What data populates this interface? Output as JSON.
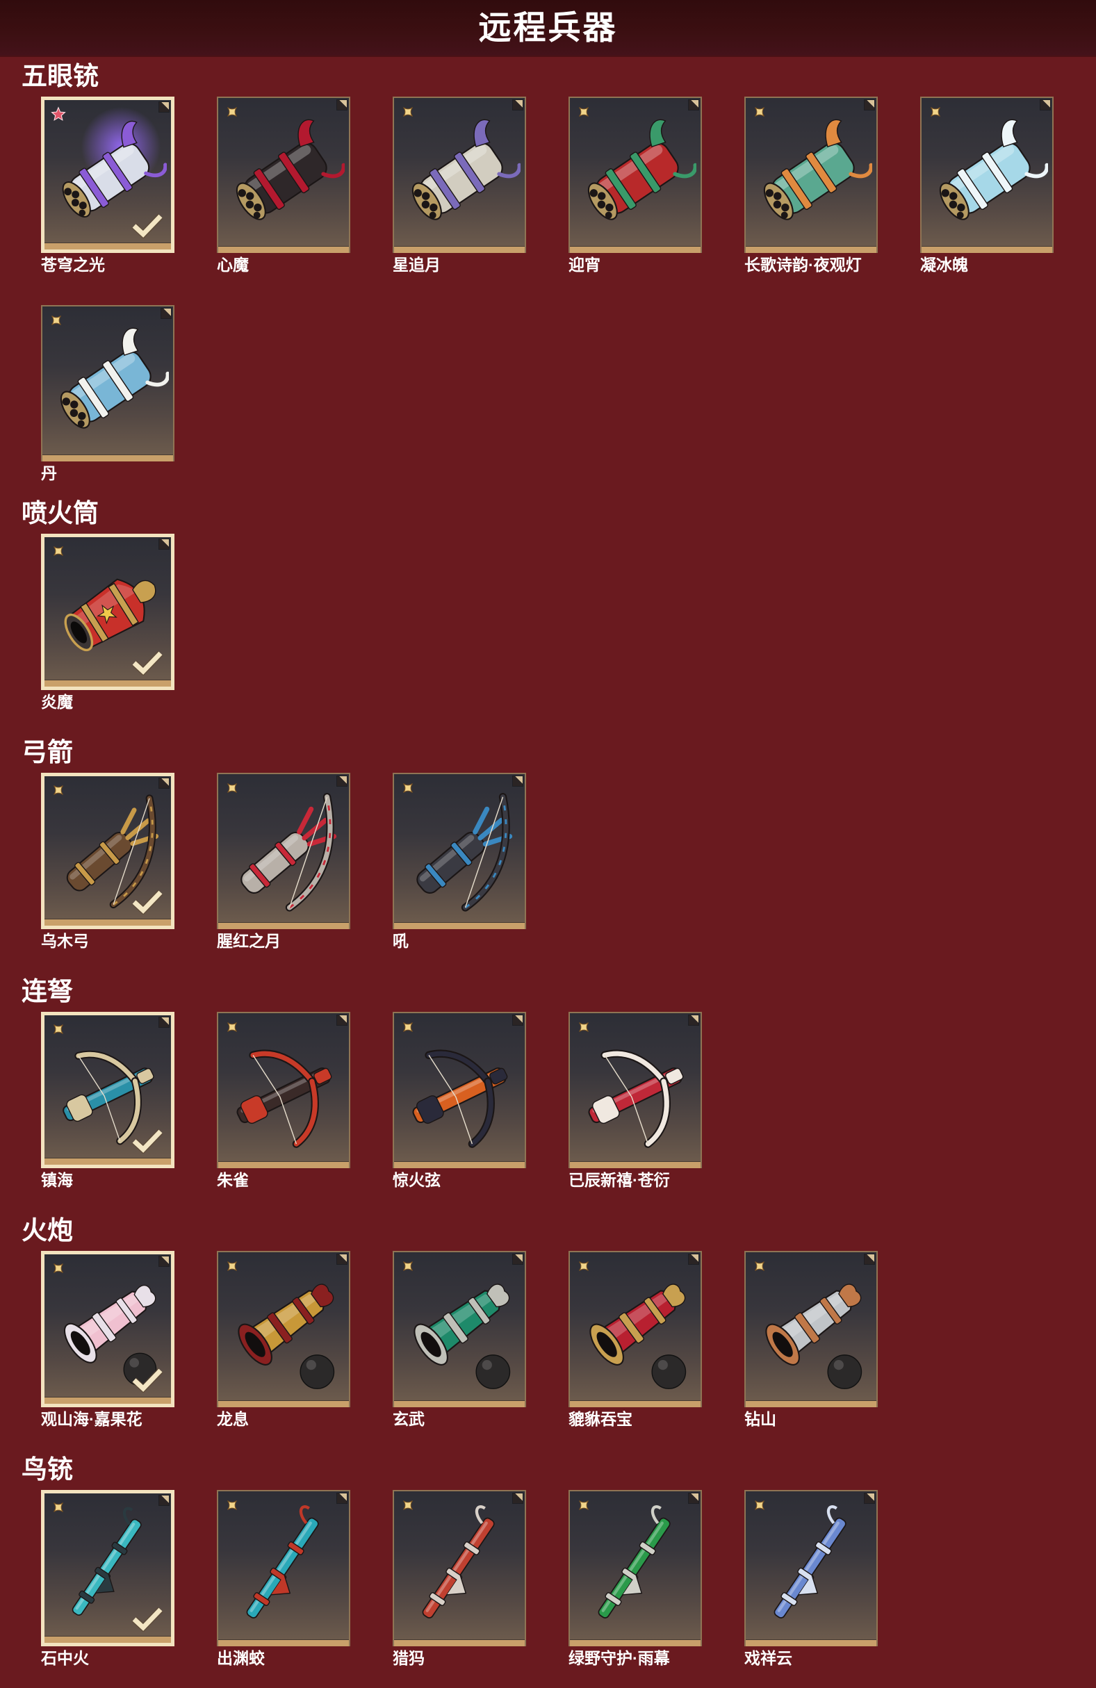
{
  "header": {
    "title": "远程兵器"
  },
  "colors": {
    "page_background": "#6a1a1f",
    "header_background": "#3b0f11",
    "frame_gold": "#c9a06a",
    "selected_border": "#f3e3bf",
    "text": "#ffffff"
  },
  "tile": {
    "corner_icon": "corner-ornament-icon",
    "check_icon": "checkmark-icon"
  },
  "sections": [
    {
      "title": "五眼铳",
      "icon": "five-barrel-gun-icon",
      "items": [
        {
          "name": "苍穹之光",
          "selected": true,
          "badge": "red-star-icon",
          "colors": [
            "#d9dde8",
            "#8b5cd6"
          ],
          "glow": "#9a6cff"
        },
        {
          "name": "心魔",
          "selected": false,
          "badge": "gold-star-icon",
          "colors": [
            "#2e2729",
            "#b3192f"
          ]
        },
        {
          "name": "星追月",
          "selected": false,
          "badge": "gold-star-icon",
          "colors": [
            "#d2cdc0",
            "#7b6bba"
          ]
        },
        {
          "name": "迎宵",
          "selected": false,
          "badge": "gold-star-icon",
          "colors": [
            "#b8292a",
            "#3a9a6a"
          ]
        },
        {
          "name": "长歌诗韵·夜观灯",
          "selected": false,
          "badge": "gold-star-icon",
          "colors": [
            "#5aa890",
            "#e08a40"
          ]
        },
        {
          "name": "凝冰魄",
          "selected": false,
          "badge": "gold-star-icon",
          "colors": [
            "#a6d8e8",
            "#eef6f9"
          ]
        },
        {
          "name": "丹",
          "selected": false,
          "badge": "gold-star-icon",
          "colors": [
            "#79b6d6",
            "#f2f2ee"
          ]
        }
      ]
    },
    {
      "title": "喷火筒",
      "icon": "flamethrower-icon",
      "items": [
        {
          "name": "炎魔",
          "selected": true,
          "badge": "gold-star-icon",
          "colors": [
            "#c8302a",
            "#c8a050"
          ]
        }
      ]
    },
    {
      "title": "弓箭",
      "icon": "bow-icon",
      "items": [
        {
          "name": "乌木弓",
          "selected": true,
          "badge": "gold-star-icon",
          "colors": [
            "#6a4a30",
            "#c89a48"
          ]
        },
        {
          "name": "腥红之月",
          "selected": false,
          "badge": "gold-star-icon",
          "colors": [
            "#b8b0a8",
            "#c82838"
          ]
        },
        {
          "name": "吼",
          "selected": false,
          "badge": "gold-star-icon",
          "colors": [
            "#3a3a42",
            "#3a88c0"
          ]
        }
      ]
    },
    {
      "title": "连弩",
      "icon": "crossbow-icon",
      "items": [
        {
          "name": "镇海",
          "selected": true,
          "badge": "gold-star-icon",
          "colors": [
            "#2a90a8",
            "#d8c8a0"
          ]
        },
        {
          "name": "朱雀",
          "selected": false,
          "badge": "gold-star-icon",
          "colors": [
            "#3a2a28",
            "#c83a28"
          ]
        },
        {
          "name": "惊火弦",
          "selected": false,
          "badge": "gold-star-icon",
          "colors": [
            "#d86020",
            "#2a2a3a"
          ]
        },
        {
          "name": "已辰新禧·苍衍",
          "selected": false,
          "badge": "gold-star-icon",
          "colors": [
            "#c02838",
            "#f0e8e0"
          ]
        }
      ]
    },
    {
      "title": "火炮",
      "icon": "cannon-icon",
      "items": [
        {
          "name": "观山海·嘉果花",
          "selected": true,
          "badge": "gold-star-icon",
          "colors": [
            "#f0c0d0",
            "#e8e0e8"
          ]
        },
        {
          "name": "龙息",
          "selected": false,
          "badge": "gold-star-icon",
          "colors": [
            "#c89838",
            "#8a2020"
          ]
        },
        {
          "name": "玄武",
          "selected": false,
          "badge": "gold-star-icon",
          "colors": [
            "#1e8a6a",
            "#c0c0b8"
          ]
        },
        {
          "name": "貔貅吞宝",
          "selected": false,
          "badge": "gold-star-icon",
          "colors": [
            "#b82030",
            "#c8a050"
          ]
        },
        {
          "name": "钻山",
          "selected": false,
          "badge": "gold-star-icon",
          "colors": [
            "#c0c4c8",
            "#c07848"
          ]
        }
      ]
    },
    {
      "title": "鸟铳",
      "icon": "musket-icon",
      "items": [
        {
          "name": "石中火",
          "selected": true,
          "badge": "gold-star-icon",
          "colors": [
            "#3ab8c0",
            "#2a3a40"
          ]
        },
        {
          "name": "出渊蛟",
          "selected": false,
          "badge": "gold-star-icon",
          "colors": [
            "#2aa8b8",
            "#c03828"
          ]
        },
        {
          "name": "猎犸",
          "selected": false,
          "badge": "gold-star-icon",
          "colors": [
            "#c04030",
            "#d8d0c8"
          ]
        },
        {
          "name": "绿野守护·雨幕",
          "selected": false,
          "badge": "gold-star-icon",
          "colors": [
            "#2a9a4a",
            "#d0d0c8"
          ]
        },
        {
          "name": "戏祥云",
          "selected": false,
          "badge": "gold-star-icon",
          "colors": [
            "#6a88d0",
            "#d8e0f0"
          ]
        }
      ]
    }
  ]
}
